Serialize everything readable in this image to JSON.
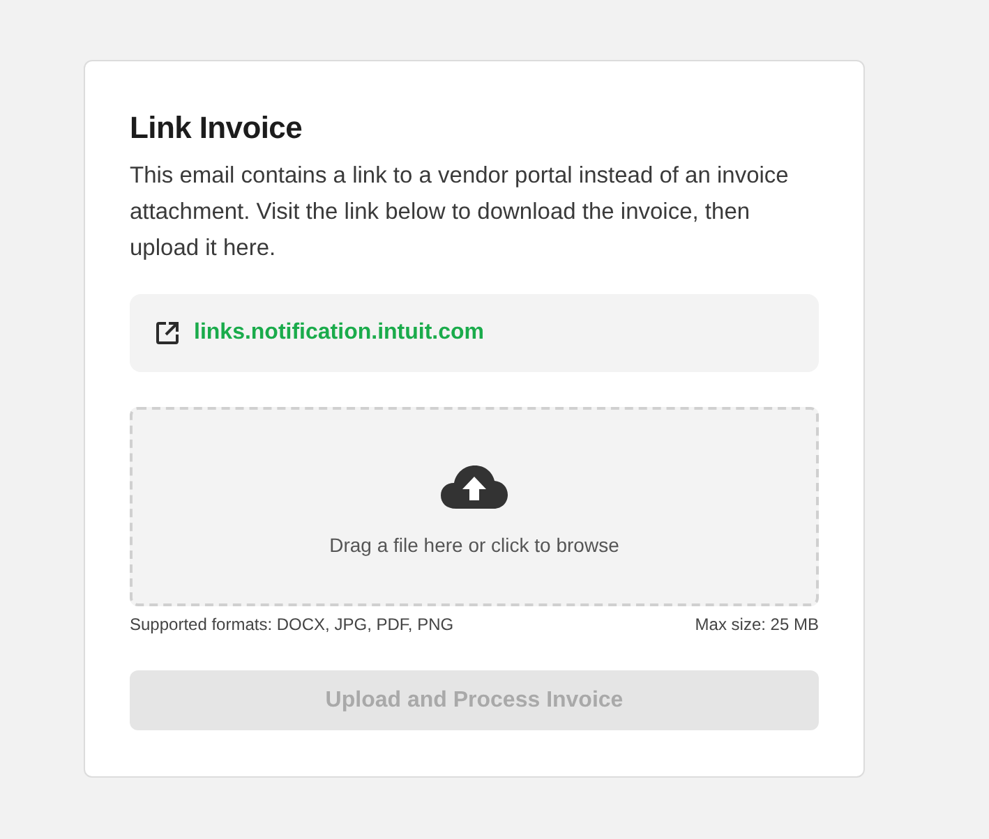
{
  "card": {
    "title": "Link Invoice",
    "description": "This email contains a link to a vendor portal instead of an invoice attachment. Visit the link below to download the invoice, then upload it here.",
    "link": {
      "text": "links.notification.intuit.com"
    },
    "dropzone": {
      "prompt": "Drag a file here or click to browse"
    },
    "formats": "Supported formats: DOCX, JPG, PDF, PNG",
    "max_size": "Max size: 25 MB",
    "submit_button": {
      "label": "Upload and Process Invoice",
      "disabled": true
    }
  }
}
